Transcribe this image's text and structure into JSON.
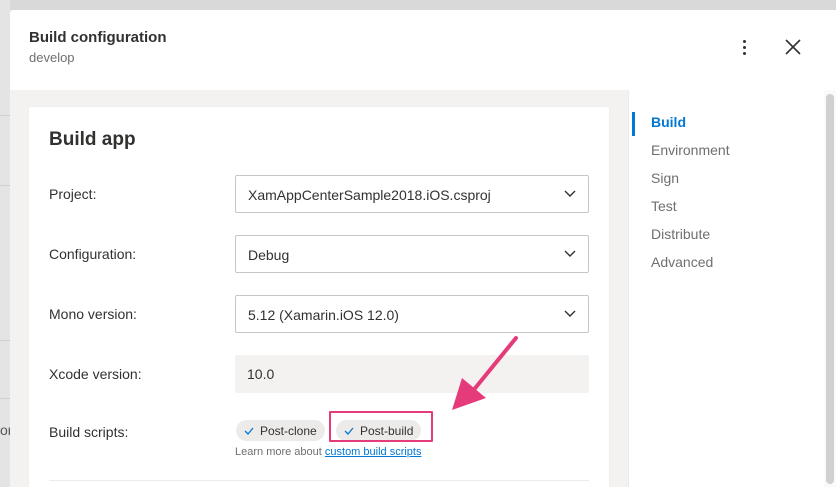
{
  "modal": {
    "title": "Build configuration",
    "subtitle": "develop",
    "more_icon": "more-vertical-icon",
    "close_icon": "close-icon"
  },
  "card": {
    "title": "Build app",
    "project": {
      "label": "Project:",
      "value": "XamAppCenterSample2018.iOS.csproj"
    },
    "configuration": {
      "label": "Configuration:",
      "value": "Debug"
    },
    "mono": {
      "label": "Mono version:",
      "value": "5.12 (Xamarin.iOS 12.0)"
    },
    "xcode": {
      "label": "Xcode version:",
      "value": "10.0"
    },
    "scripts": {
      "label": "Build scripts:",
      "items": [
        "Post-clone",
        "Post-build"
      ],
      "learn_prefix": "Learn more about ",
      "learn_link": "custom build scripts"
    }
  },
  "sidenav": {
    "items": [
      "Build",
      "Environment",
      "Sign",
      "Test",
      "Distribute",
      "Advanced"
    ],
    "active": "Build"
  },
  "background": {
    "left_text": "or"
  },
  "colors": {
    "accent": "#0078d4",
    "annotation": "#e63b7a"
  }
}
